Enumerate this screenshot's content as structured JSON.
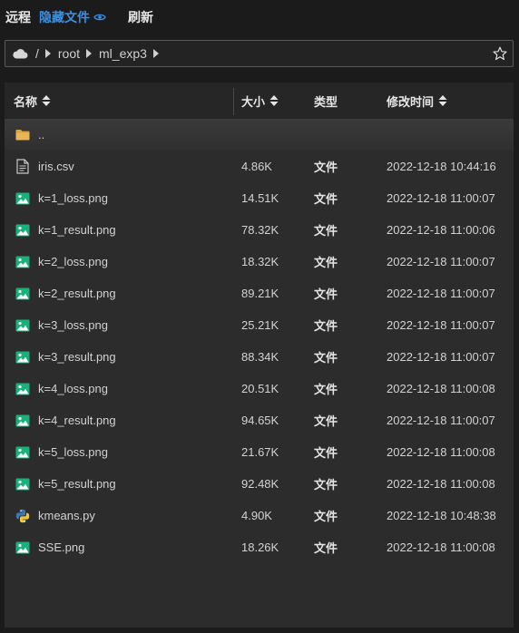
{
  "toolbar": {
    "remote_label": "远程",
    "hidden_files_label": "隐藏文件",
    "refresh_label": "刷新"
  },
  "path": {
    "separator": "/",
    "segments": [
      "root",
      "ml_exp3"
    ]
  },
  "table": {
    "headers": {
      "name": "名称",
      "size": "大小",
      "type": "类型",
      "mtime": "修改时间"
    },
    "parent_label": "..",
    "rows": [
      {
        "icon": "file-text-icon",
        "name": "iris.csv",
        "size": "4.86K",
        "type": "文件",
        "mtime": "2022-12-18 10:44:16"
      },
      {
        "icon": "image-icon",
        "name": "k=1_loss.png",
        "size": "14.51K",
        "type": "文件",
        "mtime": "2022-12-18 11:00:07"
      },
      {
        "icon": "image-icon",
        "name": "k=1_result.png",
        "size": "78.32K",
        "type": "文件",
        "mtime": "2022-12-18 11:00:06"
      },
      {
        "icon": "image-icon",
        "name": "k=2_loss.png",
        "size": "18.32K",
        "type": "文件",
        "mtime": "2022-12-18 11:00:07"
      },
      {
        "icon": "image-icon",
        "name": "k=2_result.png",
        "size": "89.21K",
        "type": "文件",
        "mtime": "2022-12-18 11:00:07"
      },
      {
        "icon": "image-icon",
        "name": "k=3_loss.png",
        "size": "25.21K",
        "type": "文件",
        "mtime": "2022-12-18 11:00:07"
      },
      {
        "icon": "image-icon",
        "name": "k=3_result.png",
        "size": "88.34K",
        "type": "文件",
        "mtime": "2022-12-18 11:00:07"
      },
      {
        "icon": "image-icon",
        "name": "k=4_loss.png",
        "size": "20.51K",
        "type": "文件",
        "mtime": "2022-12-18 11:00:08"
      },
      {
        "icon": "image-icon",
        "name": "k=4_result.png",
        "size": "94.65K",
        "type": "文件",
        "mtime": "2022-12-18 11:00:07"
      },
      {
        "icon": "image-icon",
        "name": "k=5_loss.png",
        "size": "21.67K",
        "type": "文件",
        "mtime": "2022-12-18 11:00:08"
      },
      {
        "icon": "image-icon",
        "name": "k=5_result.png",
        "size": "92.48K",
        "type": "文件",
        "mtime": "2022-12-18 11:00:08"
      },
      {
        "icon": "python-icon",
        "name": "kmeans.py",
        "size": "4.90K",
        "type": "文件",
        "mtime": "2022-12-18 10:48:38"
      },
      {
        "icon": "image-icon",
        "name": "SSE.png",
        "size": "18.26K",
        "type": "文件",
        "mtime": "2022-12-18 11:00:08"
      }
    ]
  },
  "colors": {
    "accent": "#3d8fe0",
    "image_icon": "#19b07a",
    "folder_icon": "#d9a441",
    "python_blue": "#3b78b5",
    "python_yellow": "#f2c63b"
  }
}
